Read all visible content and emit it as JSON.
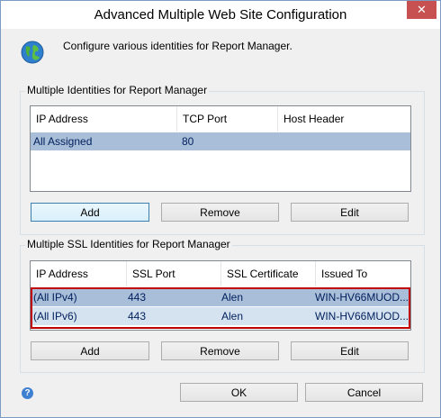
{
  "window": {
    "title": "Advanced Multiple Web Site Configuration",
    "close_glyph": "✕"
  },
  "description": "Configure various identities for Report Manager.",
  "identities": {
    "group_label": "Multiple Identities for Report Manager",
    "columns": [
      "IP Address",
      "TCP Port",
      "Host Header"
    ],
    "rows": [
      {
        "ip": "All Assigned",
        "port": "80",
        "host": ""
      }
    ],
    "buttons": {
      "add": "Add",
      "remove": "Remove",
      "edit": "Edit"
    }
  },
  "ssl": {
    "group_label": "Multiple SSL Identities for Report Manager",
    "columns": [
      "IP Address",
      "SSL Port",
      "SSL Certificate",
      "Issued To"
    ],
    "rows": [
      {
        "ip": "(All IPv4)",
        "port": "443",
        "cert": "Alen",
        "issued": "WIN-HV66MUOD..."
      },
      {
        "ip": "(All IPv6)",
        "port": "443",
        "cert": "Alen",
        "issued": "WIN-HV66MUOD..."
      }
    ],
    "buttons": {
      "add": "Add",
      "remove": "Remove",
      "edit": "Edit"
    }
  },
  "footer": {
    "ok": "OK",
    "cancel": "Cancel",
    "help_glyph": "?"
  },
  "colors": {
    "selection": "#a9bed8",
    "highlight_border": "#c00000",
    "title_bar_close": "#c75050"
  }
}
